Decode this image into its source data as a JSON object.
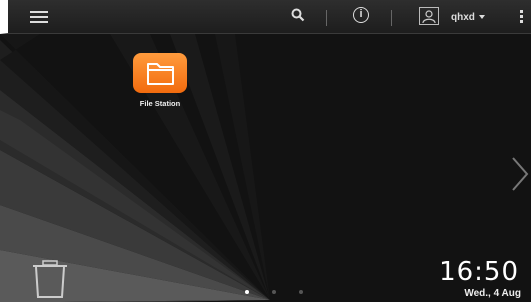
{
  "topbar": {
    "menu_icon": "hamburger-menu-icon",
    "search_icon": "search-icon",
    "info_icon": "info-icon",
    "info_glyph": "i",
    "user_icon": "user-icon",
    "username": "qhxd",
    "more_icon": "more-vertical-icon"
  },
  "desktop": {
    "apps": [
      {
        "label": "File Station",
        "icon": "folder-icon",
        "color": "#f5821f"
      }
    ],
    "page_count": 3,
    "current_page": 1
  },
  "clock": {
    "time": "16:50",
    "date": "Wed., 4 Aug"
  }
}
